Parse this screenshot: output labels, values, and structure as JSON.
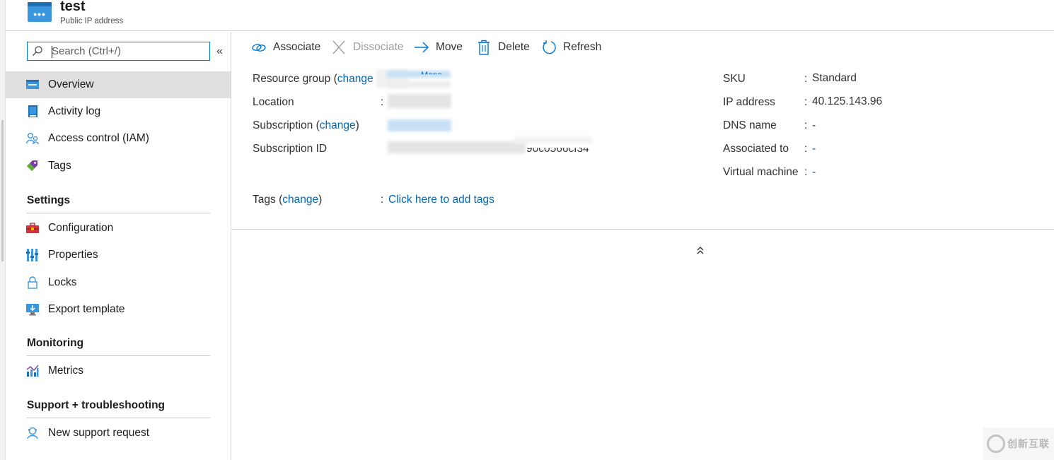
{
  "header": {
    "title": "test",
    "subtitle": "Public IP address",
    "icon": "public-ip-icon"
  },
  "sidebar": {
    "search_placeholder": "Search (Ctrl+/)",
    "collapse_glyph": "«",
    "items": [
      {
        "label": "Overview",
        "icon": "overview-icon"
      },
      {
        "label": "Activity log",
        "icon": "activity-log-icon"
      },
      {
        "label": "Access control (IAM)",
        "icon": "access-control-icon"
      },
      {
        "label": "Tags",
        "icon": "tag-icon"
      }
    ],
    "sections": [
      {
        "title": "Settings",
        "items": [
          {
            "label": "Configuration",
            "icon": "toolbox-icon"
          },
          {
            "label": "Properties",
            "icon": "properties-icon"
          },
          {
            "label": "Locks",
            "icon": "lock-icon"
          },
          {
            "label": "Export template",
            "icon": "export-template-icon"
          }
        ]
      },
      {
        "title": "Monitoring",
        "items": [
          {
            "label": "Metrics",
            "icon": "metrics-icon"
          }
        ]
      },
      {
        "title": "Support + troubleshooting",
        "items": [
          {
            "label": "New support request",
            "icon": "support-icon"
          }
        ]
      }
    ]
  },
  "toolbar": {
    "associate": "Associate",
    "dissociate": "Dissociate",
    "move": "Move",
    "delete": "Delete",
    "refresh": "Refresh"
  },
  "essentials": {
    "resource_group_label": "Resource group",
    "resource_group_change": "change",
    "resource_group_value_visible": "Mana",
    "location_label": "Location",
    "subscription_label": "Subscription",
    "subscription_change": "change",
    "subscription_id_label": "Subscription ID",
    "subscription_id_visible": "90c0566cf34",
    "tags_label": "Tags",
    "tags_change": "change",
    "tags_value": "Click here to add tags",
    "sku_label": "SKU",
    "sku_value": "Standard",
    "ip_label": "IP address",
    "ip_value": "40.125.143.96",
    "dns_label": "DNS name",
    "dns_value": "-",
    "associated_label": "Associated to",
    "associated_value": "-",
    "vm_label": "Virtual machine",
    "vm_value": "-",
    "colon": ":",
    "collapse_glyph": "⌃⌃"
  },
  "watermark": {
    "text": "创新互联"
  },
  "colors": {
    "accent": "#0078d4",
    "link": "#0067b8",
    "selected_bg": "#e1dfdd"
  }
}
